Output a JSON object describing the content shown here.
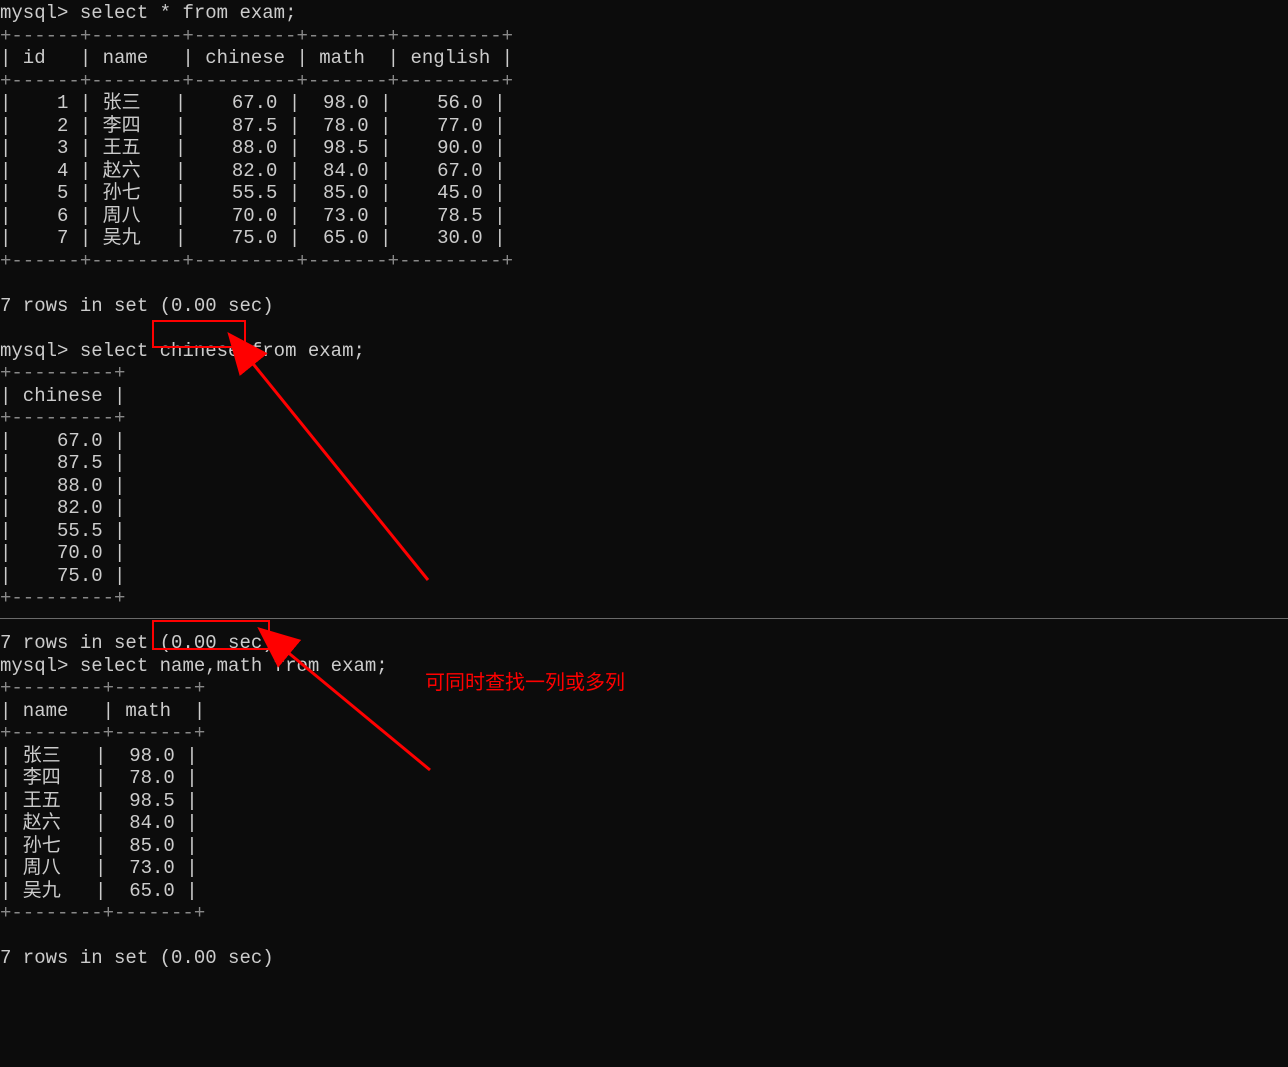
{
  "q1": {
    "prompt": "mysql>",
    "sql_pre": " select * from ",
    "sql_table": "exam",
    "sql_post": ";",
    "sep_top": "+------+--------+---------+-------+---------+",
    "header": "| id   | name   | chinese | math  | english |",
    "sep_mid": "+------+--------+---------+-------+---------+",
    "rows": [
      "|    1 | 张三   |    67.0 |  98.0 |    56.0 |",
      "|    2 | 李四   |    87.5 |  78.0 |    77.0 |",
      "|    3 | 王五   |    88.0 |  98.5 |    90.0 |",
      "|    4 | 赵六   |    82.0 |  84.0 |    67.0 |",
      "|    5 | 孙七   |    55.5 |  85.0 |    45.0 |",
      "|    6 | 周八   |    70.0 |  73.0 |    78.5 |",
      "|    7 | 吴九   |    75.0 |  65.0 |    30.0 |"
    ],
    "sep_bot": "+------+--------+---------+-------+---------+",
    "status": "7 rows in set (0.00 sec)"
  },
  "q2": {
    "prompt": "mysql>",
    "sql_pre": " select ",
    "sql_hl": "chinese",
    "sql_post": " from exam;",
    "sep_top": "+---------+",
    "header": "| chinese |",
    "sep_mid": "+---------+",
    "rows": [
      "|    67.0 |",
      "|    87.5 |",
      "|    88.0 |",
      "|    82.0 |",
      "|    55.5 |",
      "|    70.0 |",
      "|    75.0 |"
    ],
    "sep_bot": "+---------+",
    "status": "7 rows in set (0.00 sec)"
  },
  "q3": {
    "prompt": "mysql>",
    "sql_pre": " select ",
    "sql_hl": "name,math",
    "sql_post": " from exam;",
    "sep_top": "+--------+-------+",
    "header": "| name   | math  |",
    "sep_mid": "+--------+-------+",
    "rows": [
      "| 张三   |  98.0 |",
      "| 李四   |  78.0 |",
      "| 王五   |  98.5 |",
      "| 赵六   |  84.0 |",
      "| 孙七   |  85.0 |",
      "| 周八   |  73.0 |",
      "| 吴九   |  65.0 |"
    ],
    "sep_bot": "+--------+-------+",
    "status": "7 rows in set (0.00 sec)"
  },
  "annotation": "可同时查找一列或多列"
}
